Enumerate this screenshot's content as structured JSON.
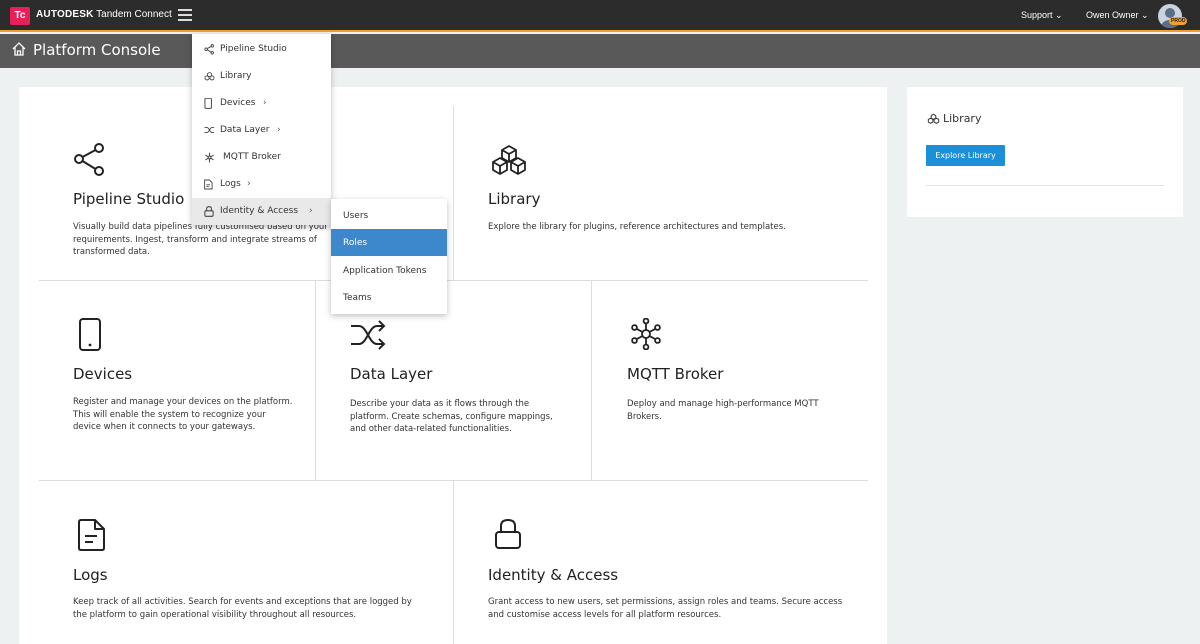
{
  "topbar": {
    "logo_text": "Tc",
    "brand_strong": "AUTODESK",
    "brand_product": "Tandem Connect",
    "support_label": "Support",
    "user_label": "Owen Owner",
    "env_badge": "PROD",
    "accent_color": "#f0a030"
  },
  "page": {
    "title": "Platform Console"
  },
  "tiles": [
    {
      "title": "Pipeline Studio",
      "desc": "Visually build data pipelines fully customised based on your requirements. Ingest, transform and integrate streams of transformed data.",
      "icon": "share-icon"
    },
    {
      "title": "Library",
      "desc": "Explore the library for plugins, reference architectures and templates.",
      "icon": "cubes-icon"
    },
    {
      "title": "Devices",
      "desc": "Register and manage your devices on the platform. This will enable the system to recognize your device when it connects to your gateways.",
      "icon": "phone-icon"
    },
    {
      "title": "Data Layer",
      "desc": "Describe your data as it flows through the platform. Create schemas, configure mappings, and other data-related functionalities.",
      "icon": "shuffle-icon"
    },
    {
      "title": "MQTT Broker",
      "desc": "Deploy and manage high-performance MQTT Brokers.",
      "icon": "hub-icon"
    },
    {
      "title": "Logs",
      "desc": "Keep track of all activities. Search for events and exceptions that are logged by the platform to gain operational visibility throughout all resources.",
      "icon": "document-icon"
    },
    {
      "title": "Identity & Access",
      "desc": "Grant access to new users, set permissions, assign roles and teams. Secure access and customise access levels for all platform resources.",
      "icon": "lock-icon"
    }
  ],
  "side": {
    "title": "Library",
    "button": "Explore Library"
  },
  "menu": {
    "items": [
      {
        "label": "Pipeline Studio",
        "has_submenu": false
      },
      {
        "label": "Library",
        "has_submenu": false
      },
      {
        "label": "Devices",
        "has_submenu": true
      },
      {
        "label": "Data Layer",
        "has_submenu": true
      },
      {
        "label": "MQTT Broker",
        "has_submenu": false
      },
      {
        "label": "Logs",
        "has_submenu": true
      },
      {
        "label": "Identity & Access",
        "has_submenu": true
      }
    ],
    "chevron": "›",
    "submenu": [
      "Users",
      "Roles",
      "Application Tokens",
      "Teams"
    ],
    "submenu_selected": "Roles"
  }
}
